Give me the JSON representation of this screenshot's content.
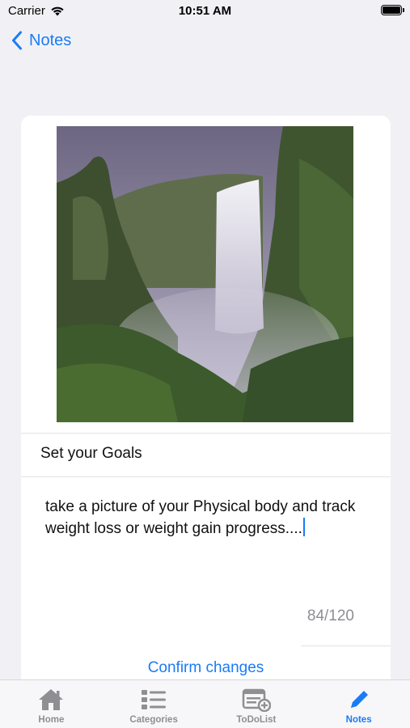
{
  "status_bar": {
    "carrier": "Carrier",
    "time": "10:51 AM",
    "wifi_icon": "wifi-icon",
    "battery_icon": "battery-icon"
  },
  "nav": {
    "back_label": "Notes",
    "back_icon": "chevron-left-icon"
  },
  "note": {
    "image": "waterfall-photo",
    "title": "Set your Goals",
    "body": "take a picture of your Physical body and track weight loss or weight gain progress....",
    "char_count": "84/120",
    "confirm_label": "Confirm changes"
  },
  "tab_bar": {
    "items": [
      {
        "label": "Home",
        "icon": "home-icon",
        "active": false
      },
      {
        "label": "Categories",
        "icon": "list-icon",
        "active": false
      },
      {
        "label": "ToDoList",
        "icon": "todo-add-icon",
        "active": false
      },
      {
        "label": "Notes",
        "icon": "pencil-icon",
        "active": true
      }
    ]
  },
  "colors": {
    "accent": "#1a7cf5",
    "background": "#f1f1f5",
    "inactive": "#8e8e93"
  }
}
